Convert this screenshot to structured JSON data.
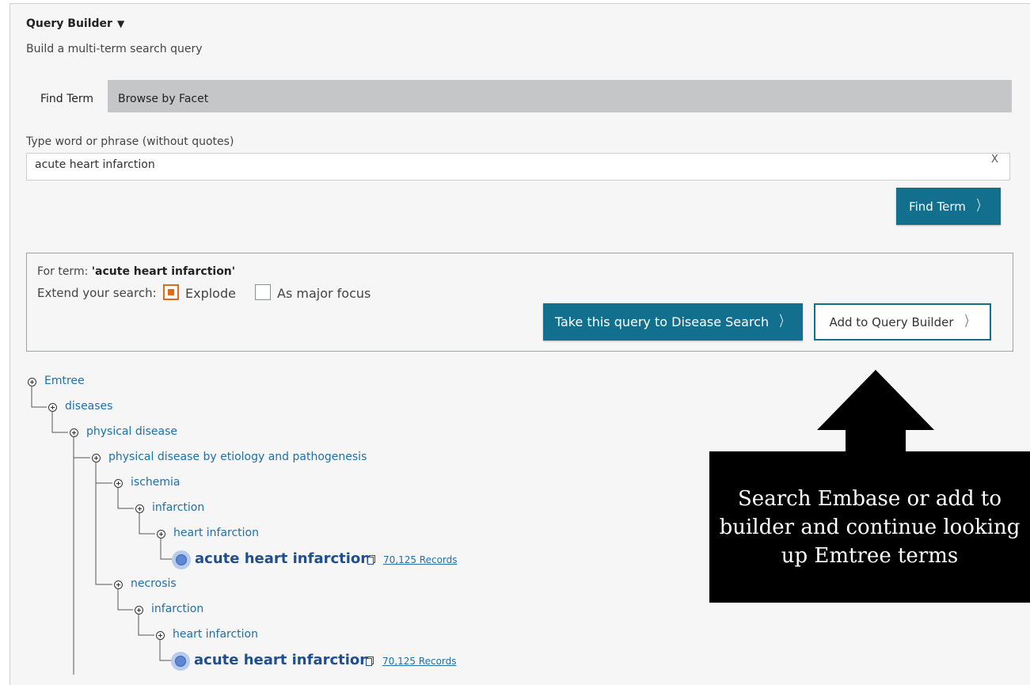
{
  "panel": {
    "title": "Query Builder",
    "title_toggle": "▼",
    "subtitle": "Build a multi-term search query"
  },
  "tabs": [
    {
      "label": "Find Term",
      "active": true
    },
    {
      "label": "Browse by Facet",
      "active": false
    }
  ],
  "search": {
    "label": "Type word or phrase (without quotes)",
    "value": "acute heart infarction",
    "clear_label": "X",
    "find_button": "Find Term",
    "chevron": "〉"
  },
  "term_panel": {
    "for_term_prefix": "For term:",
    "term": "'acute heart infarction'",
    "extend_label": "Extend your search:",
    "explode_label": "Explode",
    "explode_checked": true,
    "major_focus_label": "As major focus",
    "major_focus_checked": false,
    "disease_search_button": "Take this query to Disease Search",
    "add_builder_button": "Add to Query Builder"
  },
  "tree": {
    "nodes": [
      {
        "label": "Emtree"
      },
      {
        "label": "diseases"
      },
      {
        "label": "physical disease"
      },
      {
        "label": "physical disease by etiology and pathogenesis"
      },
      {
        "label": "ischemia"
      },
      {
        "label": "infarction"
      },
      {
        "label": "heart infarction"
      },
      {
        "label": "necrosis"
      },
      {
        "label": "infarction"
      },
      {
        "label": "heart infarction"
      }
    ],
    "leaves": [
      {
        "label": "acute heart infarction",
        "records": "70,125 Records"
      },
      {
        "label": "acute heart infarction",
        "records": "70,125 Records"
      }
    ]
  },
  "callout": {
    "text": "Search Embase or add to builder and continue looking up Emtree terms"
  },
  "colors": {
    "primary_button": "#12708e",
    "tree_link": "#1e6fa8",
    "leaf_term": "#1f4f8e",
    "explode_check": "#e2681c",
    "tab_bar": "#c4c6c8"
  }
}
